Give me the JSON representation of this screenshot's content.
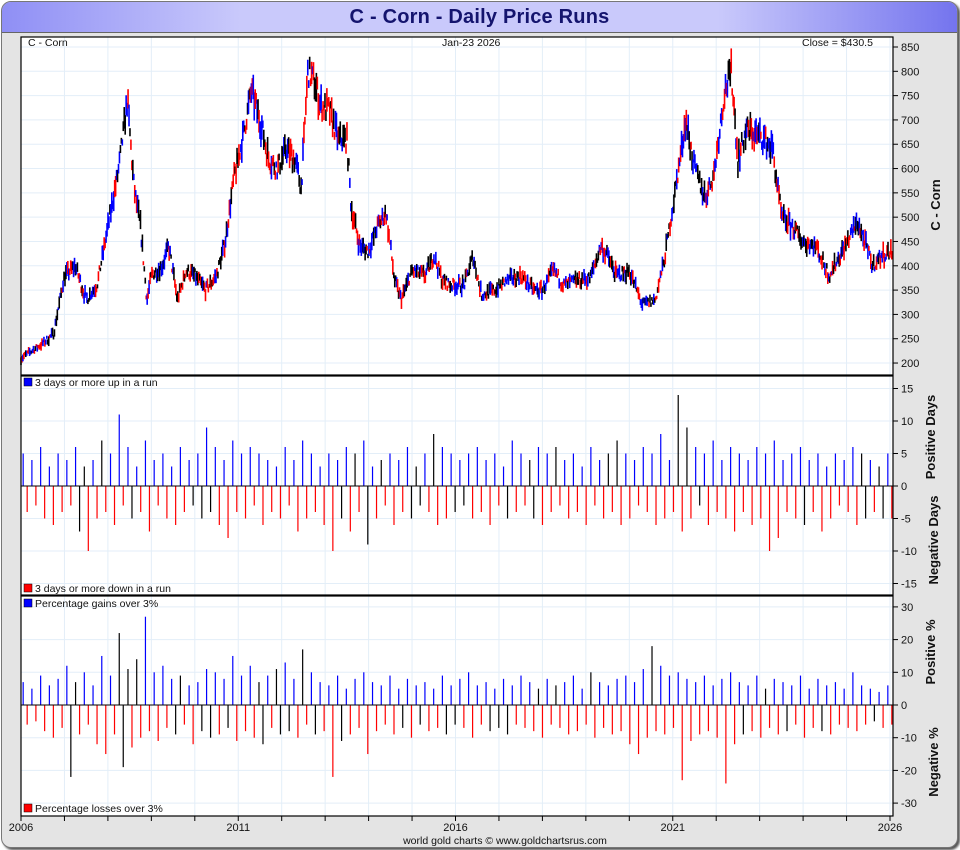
{
  "title": "C  -  Corn - Daily Price Runs",
  "header": {
    "symbol": "C  -  Corn",
    "date": "Jan-23  2026",
    "close": "Close = $430.5"
  },
  "footer": "world gold charts © www.goldchartsrus.com",
  "colors": {
    "up": "#0000ff",
    "down": "#ff0000",
    "neutral": "#000000",
    "grid": "#e3eef8",
    "title_bg": "#c9c9fb",
    "title_text": "#14146e"
  },
  "chart_data": [
    {
      "type": "line",
      "panel": "price",
      "ylabel": "C  -  Corn",
      "ylim": [
        190,
        860
      ],
      "yticks": [
        200,
        250,
        300,
        350,
        400,
        450,
        500,
        550,
        600,
        650,
        700,
        750,
        800,
        850
      ],
      "xticks": [
        "2006",
        "2011",
        "2016",
        "2021",
        "2026"
      ],
      "xlim": [
        2006,
        2026.06
      ],
      "grid": true,
      "series": [
        {
          "x": [
            2006.0,
            2006.5,
            2006.75,
            2007.0,
            2007.25,
            2007.5,
            2007.75,
            2008.0,
            2008.25,
            2008.45,
            2008.6,
            2008.75,
            2008.9,
            2009.0,
            2009.25,
            2009.4,
            2009.6,
            2009.8,
            2010.0,
            2010.25,
            2010.5,
            2010.7,
            2010.9,
            2011.1,
            2011.3,
            2011.5,
            2011.7,
            2011.9,
            2012.1,
            2012.3,
            2012.45,
            2012.6,
            2012.75,
            2012.9,
            2013.1,
            2013.3,
            2013.5,
            2013.6,
            2013.8,
            2014.0,
            2014.2,
            2014.4,
            2014.6,
            2014.75,
            2015.0,
            2015.3,
            2015.5,
            2015.7,
            2015.9,
            2016.2,
            2016.4,
            2016.6,
            2016.9,
            2017.2,
            2017.5,
            2017.8,
            2018.0,
            2018.25,
            2018.5,
            2018.8,
            2019.1,
            2019.35,
            2019.5,
            2019.7,
            2020.0,
            2020.3,
            2020.6,
            2020.8,
            2021.0,
            2021.3,
            2021.5,
            2021.75,
            2021.95,
            2022.2,
            2022.35,
            2022.5,
            2022.7,
            2022.9,
            2023.1,
            2023.3,
            2023.5,
            2023.75,
            2024.0,
            2024.3,
            2024.6,
            2024.9,
            2025.25,
            2025.45,
            2025.6,
            2025.8,
            2026.06
          ],
          "values": [
            210,
            240,
            260,
            380,
            400,
            330,
            360,
            480,
            600,
            740,
            560,
            480,
            330,
            380,
            400,
            440,
            330,
            390,
            380,
            350,
            380,
            450,
            580,
            660,
            760,
            700,
            620,
            600,
            640,
            620,
            560,
            800,
            780,
            730,
            720,
            660,
            660,
            520,
            440,
            430,
            480,
            510,
            370,
            330,
            390,
            380,
            420,
            370,
            360,
            360,
            420,
            340,
            350,
            370,
            380,
            350,
            350,
            390,
            360,
            370,
            375,
            440,
            420,
            380,
            390,
            320,
            330,
            410,
            520,
            700,
            600,
            540,
            590,
            760,
            800,
            620,
            680,
            670,
            660,
            640,
            500,
            480,
            450,
            440,
            380,
            430,
            490,
            440,
            400,
            420,
            430.5
          ]
        }
      ]
    },
    {
      "type": "bar",
      "panel": "runs",
      "ylabel_top": "Positive Days",
      "ylabel_bottom": "Negative Days",
      "legend_up": "3 days or more up in a run",
      "legend_down": "3 days or more down in a run",
      "ylim": [
        -17,
        17
      ],
      "yticks": [
        -15,
        -10,
        -5,
        0,
        5,
        10,
        15
      ],
      "x_range": [
        2006.05,
        2025.95
      ],
      "series": [
        {
          "name": "3 days or more up in a run",
          "values": [
            5,
            4,
            6,
            3,
            5,
            4,
            6,
            3,
            4,
            7,
            5,
            11,
            6,
            3,
            7,
            4,
            5,
            3,
            6,
            4,
            5,
            9,
            6,
            4,
            7,
            5,
            6,
            5,
            4,
            3,
            6,
            4,
            7,
            5,
            3,
            5,
            4,
            6,
            5,
            7,
            3,
            4,
            5,
            4,
            6,
            3,
            5,
            8,
            6,
            5,
            4,
            5,
            6,
            4,
            5,
            3,
            7,
            5,
            4,
            6,
            5,
            6,
            4,
            5,
            3,
            6,
            4,
            5,
            7,
            5,
            4,
            6,
            5,
            8,
            4,
            14,
            9,
            6,
            5,
            7,
            4,
            6,
            5,
            4,
            6,
            5,
            7,
            4,
            5,
            6,
            4,
            5,
            3,
            5,
            4,
            6,
            5,
            4,
            3,
            5
          ]
        },
        {
          "name": "3 days or more down in a run",
          "values": [
            -4,
            -3,
            -5,
            -6,
            -4,
            -3,
            -7,
            -10,
            -5,
            -4,
            -6,
            -3,
            -5,
            -4,
            -7,
            -3,
            -5,
            -6,
            -4,
            -3,
            -5,
            -4,
            -6,
            -8,
            -4,
            -5,
            -3,
            -6,
            -4,
            -5,
            -3,
            -7,
            -5,
            -4,
            -6,
            -10,
            -5,
            -7,
            -4,
            -9,
            -5,
            -3,
            -6,
            -4,
            -5,
            -3,
            -4,
            -6,
            -5,
            -4,
            -3,
            -5,
            -4,
            -6,
            -3,
            -5,
            -4,
            -3,
            -5,
            -6,
            -4,
            -3,
            -5,
            -4,
            -6,
            -3,
            -5,
            -4,
            -6,
            -5,
            -3,
            -4,
            -6,
            -5,
            -4,
            -7,
            -5,
            -3,
            -6,
            -4,
            -5,
            -7,
            -4,
            -6,
            -5,
            -10,
            -8,
            -4,
            -5,
            -6,
            -4,
            -7,
            -5,
            -3,
            -4,
            -6,
            -5,
            -4,
            -5,
            -5
          ]
        }
      ]
    },
    {
      "type": "bar",
      "panel": "percent",
      "ylabel_top": "Positive %",
      "ylabel_bottom": "Negative %",
      "legend_up": "Percentage gains over 3%",
      "legend_down": "Percentage losses over 3%",
      "ylim": [
        -33,
        33
      ],
      "yticks": [
        -30,
        -20,
        -10,
        0,
        10,
        20,
        30
      ],
      "x_range": [
        2006.05,
        2025.95
      ],
      "series": [
        {
          "name": "Percentage gains over 3%",
          "values": [
            7,
            5,
            9,
            6,
            8,
            12,
            7,
            10,
            6,
            15,
            9,
            22,
            11,
            14,
            27,
            10,
            12,
            8,
            9,
            6,
            7,
            11,
            10,
            8,
            15,
            9,
            12,
            7,
            9,
            11,
            13,
            8,
            17,
            10,
            7,
            6,
            9,
            5,
            8,
            10,
            7,
            6,
            9,
            5,
            8,
            6,
            7,
            5,
            9,
            6,
            8,
            10,
            6,
            7,
            5,
            8,
            6,
            9,
            7,
            5,
            8,
            6,
            7,
            9,
            5,
            10,
            7,
            6,
            8,
            9,
            7,
            11,
            18,
            12,
            9,
            10,
            8,
            7,
            9,
            6,
            8,
            10,
            7,
            6,
            9,
            5,
            8,
            7,
            6,
            9,
            5,
            8,
            6,
            7,
            5,
            10,
            6,
            5,
            4,
            6
          ]
        },
        {
          "name": "Percentage losses over 3%",
          "values": [
            -6,
            -5,
            -8,
            -10,
            -7,
            -22,
            -9,
            -6,
            -12,
            -15,
            -9,
            -19,
            -13,
            -10,
            -8,
            -11,
            -7,
            -9,
            -6,
            -12,
            -8,
            -10,
            -9,
            -7,
            -11,
            -8,
            -10,
            -12,
            -7,
            -9,
            -8,
            -10,
            -6,
            -9,
            -8,
            -22,
            -11,
            -9,
            -7,
            -15,
            -8,
            -6,
            -9,
            -7,
            -10,
            -6,
            -8,
            -7,
            -9,
            -6,
            -7,
            -10,
            -6,
            -8,
            -7,
            -9,
            -6,
            -7,
            -8,
            -10,
            -6,
            -7,
            -9,
            -8,
            -6,
            -10,
            -7,
            -9,
            -8,
            -12,
            -15,
            -10,
            -8,
            -9,
            -7,
            -23,
            -11,
            -9,
            -8,
            -10,
            -24,
            -12,
            -9,
            -8,
            -10,
            -7,
            -9,
            -8,
            -6,
            -10,
            -7,
            -8,
            -9,
            -6,
            -7,
            -8,
            -6,
            -5,
            -7,
            -6
          ]
        }
      ]
    }
  ]
}
